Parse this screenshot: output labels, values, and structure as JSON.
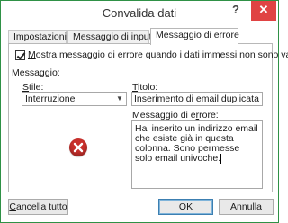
{
  "window": {
    "title": "Convalida dati",
    "help_label": "?",
    "close_label": "✕",
    "border_color": "#2f9146"
  },
  "tabs": [
    {
      "label": "Impostazioni",
      "active": false
    },
    {
      "label": "Messaggio di input",
      "active": false
    },
    {
      "label": "Messaggio di errore",
      "active": true
    }
  ],
  "error_tab": {
    "show_error_checkbox": {
      "label": "Mostra messaggio di errore quando i dati immessi non sono validi",
      "checked": true
    },
    "section_label": "Messaggio:",
    "style_label": "Stile:",
    "style_value": "Interruzione",
    "title_label": "Titolo:",
    "title_value": "Inserimento di email duplicata",
    "message_label": "Messaggio di errore:",
    "message_value": "Hai inserito un indirizzo email che esiste già in questa colonna. Sono permesse solo email univoche.",
    "icon": "error-stop-icon",
    "icon_color": "#c9302c"
  },
  "buttons": {
    "clear_all": "Cancella tutto",
    "ok": "OK",
    "cancel": "Annulla"
  }
}
